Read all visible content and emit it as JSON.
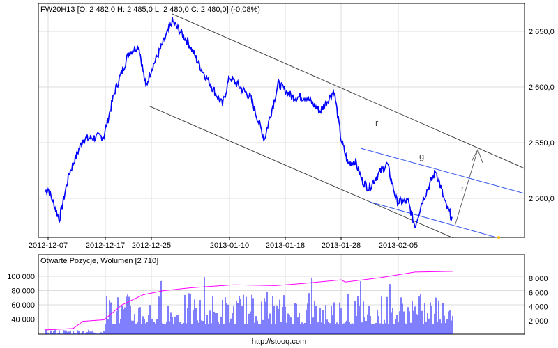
{
  "chart_data": [
    {
      "type": "line",
      "title": "FW20H13 [O: 2 482,0  H: 2 485,0  L: 2 480,0  C: 2 480,0] (-0,08%)",
      "ylim": [
        2465,
        2665
      ],
      "yticks": [
        {
          "v": 2650,
          "label": "2 650,0"
        },
        {
          "v": 2600,
          "label": "2 600,0"
        },
        {
          "v": 2550,
          "label": "2 550,0"
        },
        {
          "v": 2500,
          "label": "2 500,0"
        }
      ],
      "xticks": [
        {
          "i": 2,
          "label": "2012-12-07"
        },
        {
          "i": 43,
          "label": "2012-12-17"
        },
        {
          "i": 76,
          "label": "2012-12-25"
        },
        {
          "i": 132,
          "label": "2013-01-10"
        },
        {
          "i": 172,
          "label": "2013-01-18"
        },
        {
          "i": 212,
          "label": "2013-01-28"
        },
        {
          "i": 253,
          "label": "2013-02-05"
        }
      ],
      "xlim": [
        -5,
        344
      ],
      "series": [
        {
          "name": "FW20H13",
          "color": "#0000ff",
          "points": [
            [
              0,
              2506
            ],
            [
              2,
              2509
            ],
            [
              10,
              2481
            ],
            [
              17,
              2522
            ],
            [
              27,
              2553
            ],
            [
              42,
              2556
            ],
            [
              50,
              2597
            ],
            [
              60,
              2631
            ],
            [
              67,
              2637
            ],
            [
              72,
              2600
            ],
            [
              76,
              2616
            ],
            [
              85,
              2641
            ],
            [
              91,
              2659
            ],
            [
              102,
              2641
            ],
            [
              112,
              2616
            ],
            [
              127,
              2584
            ],
            [
              132,
              2609
            ],
            [
              147,
              2591
            ],
            [
              157,
              2553
            ],
            [
              167,
              2603
            ],
            [
              177,
              2591
            ],
            [
              187,
              2591
            ],
            [
              197,
              2578
            ],
            [
              207,
              2597
            ],
            [
              212,
              2553
            ],
            [
              217,
              2531
            ],
            [
              222,
              2534
            ],
            [
              227,
              2516
            ],
            [
              232,
              2509
            ],
            [
              237,
              2519
            ],
            [
              245,
              2531
            ],
            [
              252,
              2497
            ],
            [
              260,
              2497
            ],
            [
              265,
              2475
            ],
            [
              270,
              2497
            ],
            [
              280,
              2525
            ],
            [
              287,
              2494
            ],
            [
              292,
              2481
            ]
          ]
        }
      ],
      "annotations": [
        {
          "type": "label",
          "text": "r"
        },
        {
          "type": "label",
          "text": "g"
        },
        {
          "type": "label",
          "text": "r"
        }
      ]
    },
    {
      "type": "bar",
      "title": "Otwarte Pozycje, Wolumen [2 710]",
      "left_yticks": [
        {
          "v": 100000,
          "label": "100 000"
        },
        {
          "v": 80000,
          "label": "80 000"
        },
        {
          "v": 60000,
          "label": "60 000"
        },
        {
          "v": 40000,
          "label": "40 000"
        }
      ],
      "right_yticks": [
        {
          "v": 8000,
          "label": "8 000"
        },
        {
          "v": 6000,
          "label": "6 000"
        },
        {
          "v": 4000,
          "label": "4 000"
        },
        {
          "v": 2000,
          "label": "2 000"
        }
      ],
      "oi_series": {
        "name": "Otwarte Pozycje",
        "color": "#ff00ff",
        "points": [
          [
            0,
            25000
          ],
          [
            20,
            27000
          ],
          [
            27,
            37000
          ],
          [
            42,
            39000
          ],
          [
            55,
            60000
          ],
          [
            70,
            74000
          ],
          [
            85,
            80000
          ],
          [
            105,
            84000
          ],
          [
            135,
            88000
          ],
          [
            165,
            87000
          ],
          [
            185,
            90000
          ],
          [
            212,
            95000
          ],
          [
            215,
            92000
          ],
          [
            240,
            98000
          ],
          [
            265,
            106000
          ],
          [
            292,
            107000
          ]
        ]
      },
      "volume_series": {
        "name": "Wolumen",
        "color": "#0000ff",
        "last": 2710
      }
    }
  ],
  "footer": "http://stooq.com"
}
